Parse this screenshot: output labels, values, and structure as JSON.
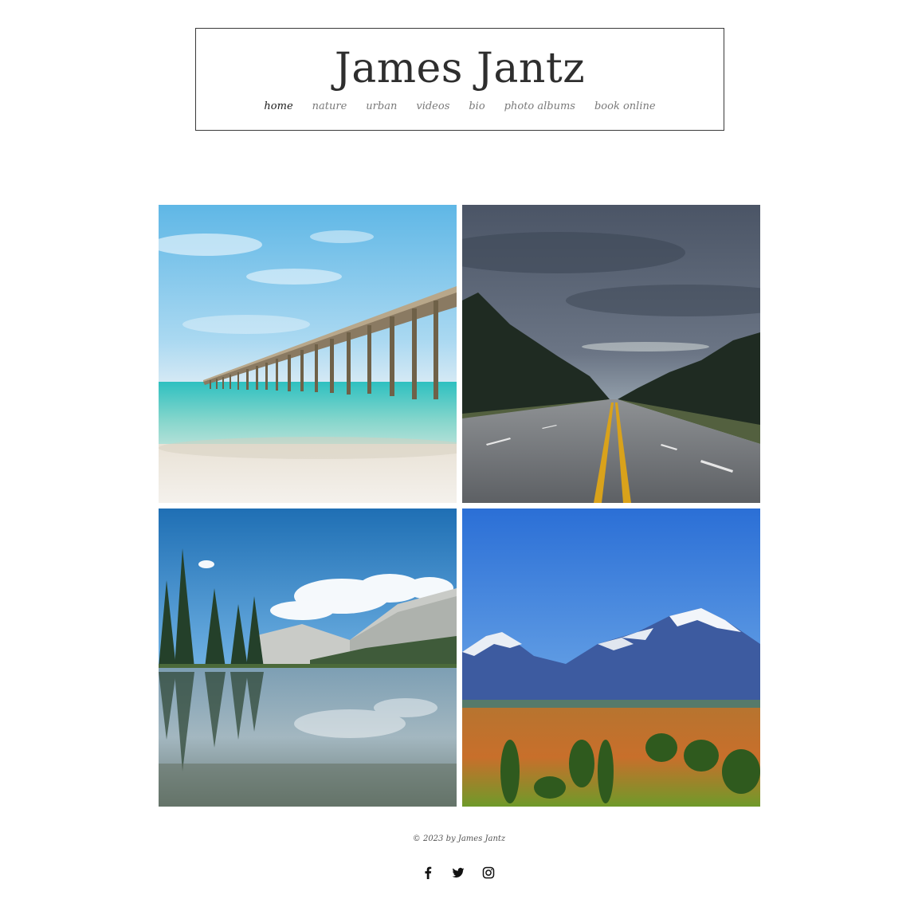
{
  "site": {
    "title": "James Jantz"
  },
  "nav": {
    "items": [
      {
        "label": "home",
        "active": true
      },
      {
        "label": "nature",
        "active": false
      },
      {
        "label": "urban",
        "active": false
      },
      {
        "label": "videos",
        "active": false
      },
      {
        "label": "bio",
        "active": false
      },
      {
        "label": "photo albums",
        "active": false
      },
      {
        "label": "book online",
        "active": false
      }
    ]
  },
  "gallery": {
    "images": [
      {
        "subject": "ocean-pier-photo"
      },
      {
        "subject": "highway-road-photo"
      },
      {
        "subject": "mountain-lake-photo"
      },
      {
        "subject": "snowy-mountains-photo"
      }
    ]
  },
  "footer": {
    "copyright": "© 2023 by James Jantz",
    "social": [
      {
        "icon": "facebook-icon"
      },
      {
        "icon": "twitter-icon"
      },
      {
        "icon": "instagram-icon"
      }
    ]
  },
  "colors": {
    "text_dark": "#2e2e2e",
    "nav_inactive": "#7a7a7a",
    "border": "#3a3a3a"
  }
}
